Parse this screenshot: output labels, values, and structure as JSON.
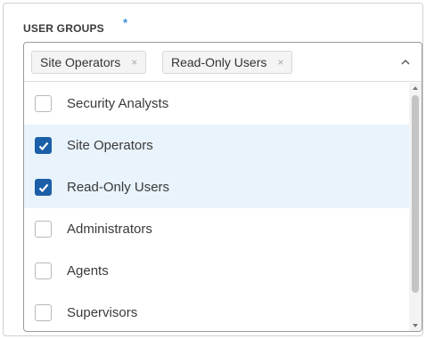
{
  "field": {
    "label": "USER GROUPS",
    "required_mark": "*"
  },
  "selected_chips": [
    {
      "label": "Site Operators",
      "remove": "×"
    },
    {
      "label": "Read-Only Users",
      "remove": "×"
    }
  ],
  "options": [
    {
      "label": "Security Analysts",
      "checked": false
    },
    {
      "label": "Site Operators",
      "checked": true
    },
    {
      "label": "Read-Only Users",
      "checked": true
    },
    {
      "label": "Administrators",
      "checked": false
    },
    {
      "label": "Agents",
      "checked": false
    },
    {
      "label": "Supervisors",
      "checked": false
    }
  ],
  "icons": {
    "toggle": "chevron-up-icon",
    "check": "checkmark-icon",
    "remove": "close-icon"
  },
  "colors": {
    "accent": "#1b5fa8",
    "selected_row": "#e9f3fb",
    "required": "#3d8ee0"
  }
}
